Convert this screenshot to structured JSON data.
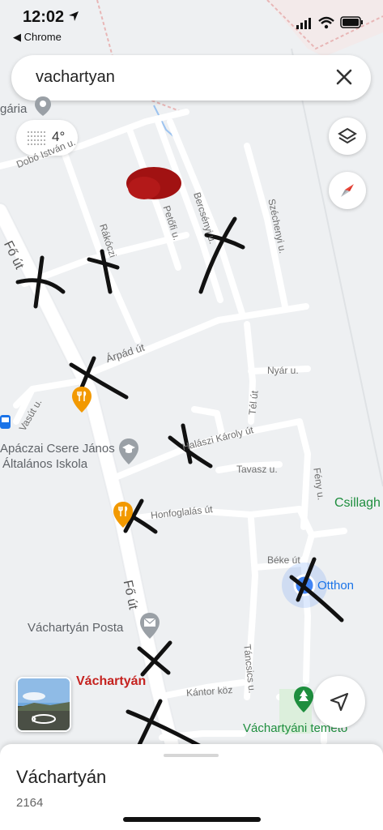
{
  "status_bar": {
    "time": "12:02",
    "back_app": "◀ Chrome"
  },
  "search": {
    "query": "vachartyan"
  },
  "weather": {
    "temperature": "4°"
  },
  "streets": {
    "dobo": "Dobó István u.",
    "rakoczi": "Rákóczi",
    "petofi": "Petőfi u.",
    "bercsenyi": "Bercsényi u.",
    "szechenyi": "Széchenyi u.",
    "fo_ut_top": "Fő út",
    "arpad": "Árpád út",
    "nyar": "Nyár u.",
    "tel": "Tél út",
    "vasut": "Vasút u.",
    "halaszi": "Halászi Károly út",
    "tavasz": "Tavasz u.",
    "feny": "Fény u.",
    "honfoglalas": "Honfoglalás út",
    "beke": "Béke út",
    "fo_ut_bottom": "Fő út",
    "tancsics": "Táncsics u.",
    "kantor": "Kántor köz"
  },
  "pois": {
    "garia": "gária",
    "school_line1": "Apáczai Csere János",
    "school_line2": "Általános Iskola",
    "csillag": "Csillagh",
    "otthon": "Otthon",
    "posta": "Váchartyán Posta",
    "town": "Váchartyán",
    "cemetery": "Váchartyáni temető"
  },
  "place_sheet": {
    "name": "Váchartyán",
    "postal_code": "2164"
  },
  "colors": {
    "map_bg": "#eef0f2",
    "road": "#ffffff",
    "town_label": "#c5221f",
    "park_label": "#1e8e3e",
    "location_blue": "#4285f4",
    "food_orange": "#f29900"
  }
}
